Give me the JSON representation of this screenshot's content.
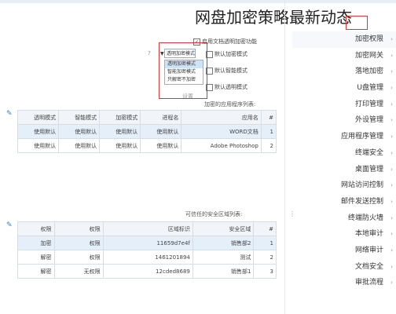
{
  "title": "网盘加密策略最新动态",
  "settings": {
    "option_top": "启用文档透明加密功能",
    "select_value": "透明加密模式",
    "help_mark": "?",
    "dropdown_options": [
      "透明加密模式",
      "智能加密模式",
      "只解密不加密"
    ],
    "options": [
      "默认加密模式",
      "默认智能模式",
      "默认透明模式"
    ],
    "partial_label": "设置",
    "section1_label": "加密的应用程序列表:",
    "section2_label": "可信任的安全区域列表:"
  },
  "table1": {
    "headers": [
      "#",
      "应用名",
      "进程名",
      "加密模式",
      "智能模式",
      "透明模式"
    ],
    "rows": [
      [
        "1",
        "WORD文档",
        "使用默认",
        "使用默认",
        "使用默认",
        "使用默认"
      ],
      [
        "2",
        "Adobe Photoshop",
        "使用默认",
        "使用默认",
        "使用默认",
        "使用默认"
      ]
    ]
  },
  "table2": {
    "headers": [
      "#",
      "安全区域",
      "区域标识",
      "权限",
      "权限"
    ],
    "rows": [
      [
        "1",
        "销售部2",
        "11659d7e4f",
        "权限",
        "加密"
      ],
      [
        "2",
        "测试",
        "1461201894",
        "权限",
        "解密"
      ],
      [
        "3",
        "销售部1",
        "12cded8689",
        "无权限",
        "解密"
      ]
    ]
  },
  "sidebar": {
    "items": [
      "加密权限",
      "加密网关",
      "落地加密",
      "U盘管理",
      "打印管理",
      "外设管理",
      "应用程序管理",
      "终端安全",
      "桌面管理",
      "网站访问控制",
      "邮件发送控制",
      "终端防火墙",
      "本地审计",
      "网络审计",
      "文档安全",
      "审批流程"
    ]
  }
}
